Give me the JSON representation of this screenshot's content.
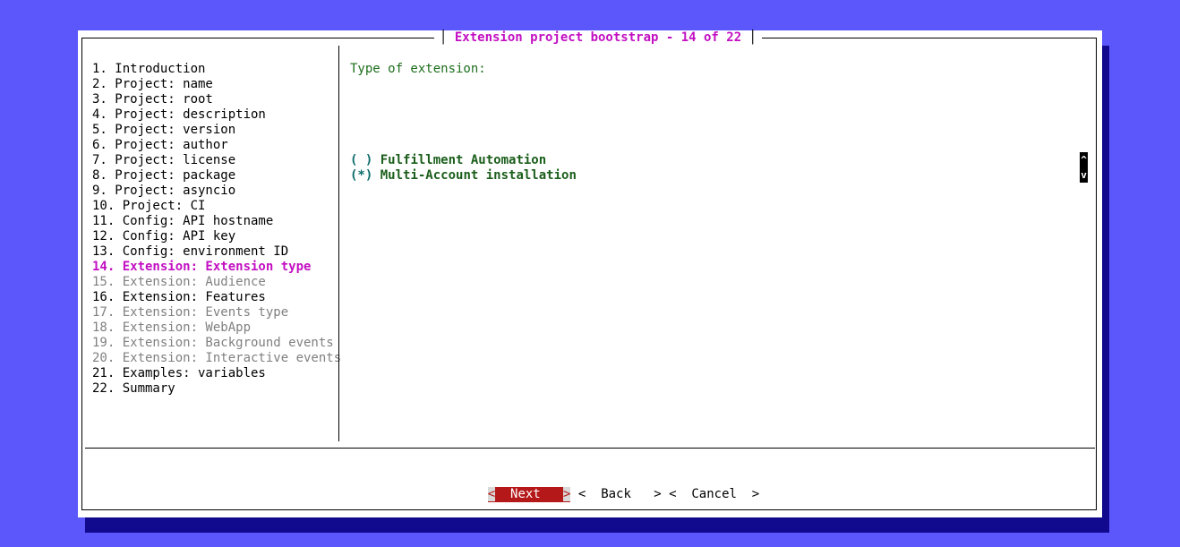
{
  "dialog": {
    "title": "Extension project bootstrap - 14 of 22",
    "steps": [
      {
        "label": "1. Introduction",
        "state": "done"
      },
      {
        "label": "2. Project: name",
        "state": "done"
      },
      {
        "label": "3. Project: root",
        "state": "done"
      },
      {
        "label": "4. Project: description",
        "state": "done"
      },
      {
        "label": "5. Project: version",
        "state": "done"
      },
      {
        "label": "6. Project: author",
        "state": "done"
      },
      {
        "label": "7. Project: license",
        "state": "done"
      },
      {
        "label": "8. Project: package",
        "state": "done"
      },
      {
        "label": "9. Project: asyncio",
        "state": "done"
      },
      {
        "label": "10. Project: CI",
        "state": "done"
      },
      {
        "label": "11. Config: API hostname",
        "state": "done"
      },
      {
        "label": "12. Config: API key",
        "state": "done"
      },
      {
        "label": "13. Config: environment ID",
        "state": "done"
      },
      {
        "label": "14. Extension: Extension type",
        "state": "active"
      },
      {
        "label": "15. Extension: Audience",
        "state": "disabled"
      },
      {
        "label": "16. Extension: Features",
        "state": "done"
      },
      {
        "label": "17. Extension: Events type",
        "state": "disabled"
      },
      {
        "label": "18. Extension: WebApp",
        "state": "disabled"
      },
      {
        "label": "19. Extension: Background events",
        "state": "disabled"
      },
      {
        "label": "20. Extension: Interactive events",
        "state": "disabled"
      },
      {
        "label": "21. Examples: variables",
        "state": "done"
      },
      {
        "label": "22. Summary",
        "state": "done"
      }
    ],
    "prompt": "Type of extension:",
    "options": [
      {
        "mark": "( )",
        "label": "Fulfillment Automation",
        "selected": false
      },
      {
        "mark": "(*)",
        "label": "Multi-Account installation",
        "selected": true
      }
    ],
    "scrollbar": {
      "up": "^",
      "down": "v"
    },
    "buttons": {
      "next": "Next",
      "back": "Back",
      "cancel": "Cancel",
      "focused": "next"
    }
  },
  "colors": {
    "background": "#5b57fb",
    "shadow": "#120a8e",
    "active_step": "#c20fc2",
    "disabled_step": "#808080",
    "prompt": "#1d6e1d",
    "focused_button": "#b51818"
  }
}
